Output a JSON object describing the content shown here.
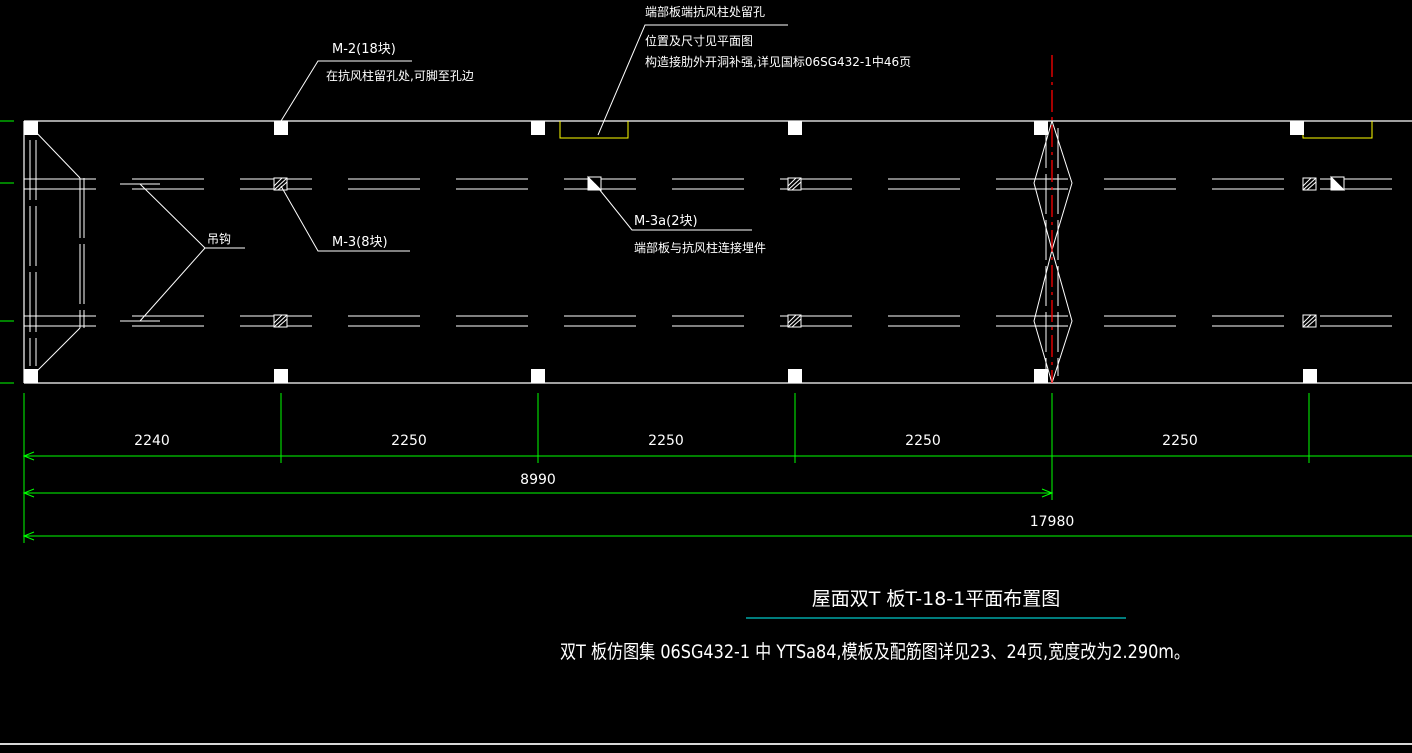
{
  "drawing": {
    "title": "屋面双T 板T-18-1平面布置图",
    "subtitle": "双T 板仿图集 06SG432-1 中 YTSa84,模板及配筋图详见23、24页,宽度改为2.290m。",
    "colors": {
      "background": "#000000",
      "outline": "#ffffff",
      "dimension": "#00ff00",
      "axis_line": "#ff0000",
      "opening": "#ffff00",
      "title_rule": "#00c8c8"
    }
  },
  "annotations": {
    "m2_label": "M-2(18块)",
    "m2_note": "在抗风柱留孔处,可脚至孔边",
    "top_note_head": "端部板端抗风柱处留孔",
    "top_note_line1": "位置及尺寸见平面图",
    "top_note_line2": "构造接肋外开洞补强,详见国标06SG432-1中46页",
    "hook_label": "吊钩",
    "m3_label": "M-3(8块)",
    "m3a_label": "M-3a(2块)",
    "m3a_note": "端部板与抗风柱连接埋件"
  },
  "dimensions": {
    "spans": [
      "2240",
      "2250",
      "2250",
      "2250",
      "2250"
    ],
    "half_total": "8990",
    "total": "17980"
  }
}
